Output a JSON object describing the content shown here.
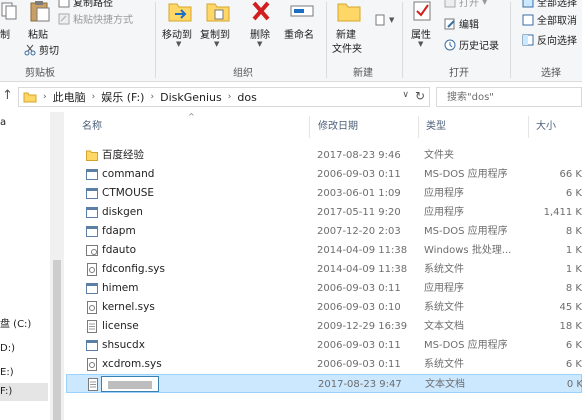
{
  "ribbon": {
    "clipboard": {
      "cut_label": "制",
      "paste_label": "粘贴",
      "cut_btn_label": "剪切",
      "copy_path_label": "复制路径",
      "paste_shortcut_label": "粘贴快捷方式",
      "group_label": "剪贴板"
    },
    "organize": {
      "move_to_label": "移动到",
      "copy_to_label": "复制到",
      "delete_label": "删除",
      "rename_label": "重命名",
      "group_label": "组织"
    },
    "new": {
      "new_folder_line1": "新建",
      "new_folder_line2": "文件夹",
      "group_label": "新建"
    },
    "open": {
      "properties_label": "属性",
      "open_label": "打开",
      "edit_label": "编辑",
      "history_label": "历史记录",
      "group_label": "打开"
    },
    "select": {
      "select_all_label": "全部选择",
      "select_none_label": "全部取消",
      "invert_label": "反向选择",
      "group_label": "选择"
    }
  },
  "address": {
    "crumbs": [
      "此电脑",
      "娱乐 (F:)",
      "DiskGenius",
      "dos"
    ],
    "search_placeholder": "搜索\"dos\""
  },
  "nav": {
    "items": [
      {
        "label": "a",
        "selected": false
      },
      {
        "label": "盘 (C:)",
        "selected": false
      },
      {
        "label": "D:)",
        "selected": false
      },
      {
        "label": "E:)",
        "selected": false
      },
      {
        "label": "F:)",
        "selected": true
      }
    ]
  },
  "columns": {
    "name": "名称",
    "date": "修改日期",
    "type": "类型",
    "size": "大小"
  },
  "files": [
    {
      "name": "百度经验",
      "date": "2017-08-23 9:46",
      "type": "文件夹",
      "size": "",
      "icon": "folder-icon"
    },
    {
      "name": "command",
      "date": "2006-09-03 0:11",
      "type": "MS-DOS 应用程序",
      "size": "66 K",
      "icon": "exe-icon"
    },
    {
      "name": "CTMOUSE",
      "date": "2003-06-01 1:09",
      "type": "应用程序",
      "size": "6 K",
      "icon": "exe-icon"
    },
    {
      "name": "diskgen",
      "date": "2017-05-11 9:20",
      "type": "应用程序",
      "size": "1,411 K",
      "icon": "exe-icon"
    },
    {
      "name": "fdapm",
      "date": "2007-12-20 2:03",
      "type": "MS-DOS 应用程序",
      "size": "8 K",
      "icon": "exe-icon"
    },
    {
      "name": "fdauto",
      "date": "2014-04-09 11:38",
      "type": "Windows 批处理...",
      "size": "1 K",
      "icon": "bat-icon"
    },
    {
      "name": "fdconfig.sys",
      "date": "2014-04-09 11:38",
      "type": "系统文件",
      "size": "1 K",
      "icon": "sys-icon"
    },
    {
      "name": "himem",
      "date": "2006-09-03 0:11",
      "type": "应用程序",
      "size": "8 K",
      "icon": "exe-icon"
    },
    {
      "name": "kernel.sys",
      "date": "2006-09-03 0:10",
      "type": "系统文件",
      "size": "45 K",
      "icon": "sys-icon"
    },
    {
      "name": "license",
      "date": "2009-12-29 16:39",
      "type": "文本文档",
      "size": "18 K",
      "icon": "txt-icon"
    },
    {
      "name": "shsucdx",
      "date": "2006-09-03 0:11",
      "type": "MS-DOS 应用程序",
      "size": "6 K",
      "icon": "exe-icon"
    },
    {
      "name": "xcdrom.sys",
      "date": "2006-09-03 0:11",
      "type": "系统文件",
      "size": "6 K",
      "icon": "sys-icon"
    },
    {
      "name": "",
      "date": "2017-08-23 9:47",
      "type": "文本文档",
      "size": "0 K",
      "icon": "txt-icon",
      "renaming": true
    }
  ],
  "colors": {
    "accent": "#0078d7",
    "selection_bg": "#cce8ff",
    "folder": "#ffd766"
  }
}
